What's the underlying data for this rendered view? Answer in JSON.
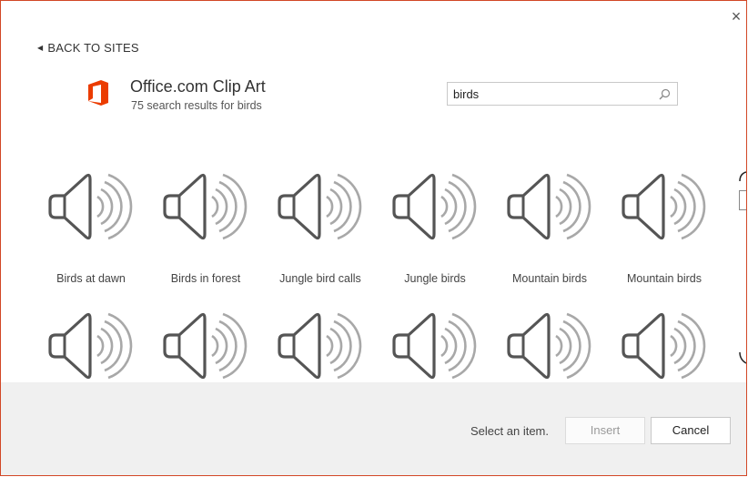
{
  "dialog": {
    "close_glyph": "×",
    "back_label": "BACK TO SITES",
    "provider": {
      "title": "Office.com Clip Art",
      "subtitle": "75 search results for birds",
      "brand_color": "#eb3c00"
    },
    "search": {
      "value": "birds",
      "placeholder": ""
    },
    "results_row1": [
      {
        "label": "Birds at dawn",
        "icon": "speaker-audio-icon"
      },
      {
        "label": "Birds in forest",
        "icon": "speaker-audio-icon"
      },
      {
        "label": "Jungle bird calls",
        "icon": "speaker-audio-icon"
      },
      {
        "label": "Jungle birds",
        "icon": "speaker-audio-icon"
      },
      {
        "label": "Mountain birds",
        "icon": "speaker-audio-icon"
      },
      {
        "label": "Mountain birds",
        "icon": "speaker-audio-icon"
      }
    ],
    "results_row2": [
      {
        "label": "",
        "icon": "speaker-audio-icon"
      },
      {
        "label": "",
        "icon": "speaker-audio-icon"
      },
      {
        "label": "",
        "icon": "speaker-audio-icon"
      },
      {
        "label": "",
        "icon": "speaker-audio-icon"
      },
      {
        "label": "",
        "icon": "speaker-audio-icon"
      },
      {
        "label": "",
        "icon": "speaker-audio-icon"
      }
    ],
    "footer": {
      "status": "Select an item.",
      "insert_label": "Insert",
      "cancel_label": "Cancel"
    }
  }
}
